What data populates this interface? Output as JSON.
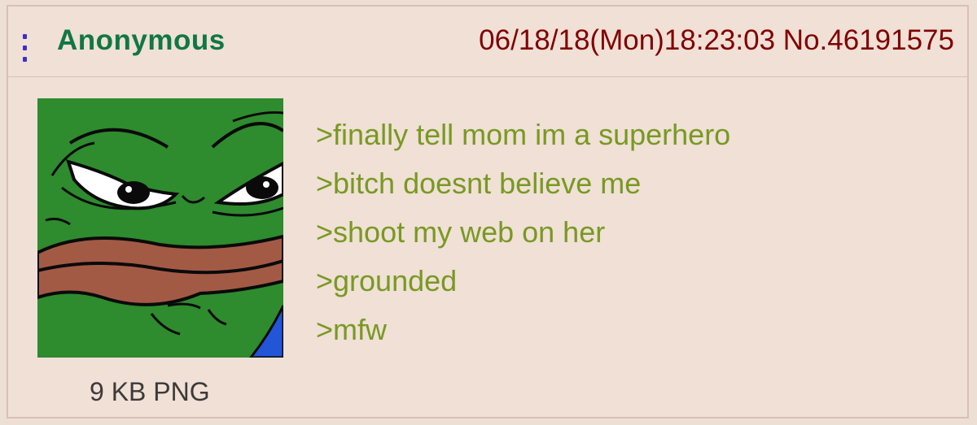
{
  "post": {
    "name": "Anonymous",
    "datetime": "06/18/18(Mon)18:23:03",
    "number": "No.46191575",
    "file_info": "9 KB PNG",
    "thumbnail_icon": "pepe-frog-face-image",
    "lines": [
      ">finally tell mom im a superhero",
      ">bitch doesnt believe me",
      ">shoot my web on her",
      ">grounded",
      ">mfw"
    ]
  },
  "colors": {
    "background": "#f0e0d6",
    "border": "#d9bfb7",
    "name": "#117743",
    "meta": "#800000",
    "greentext": "#789922"
  }
}
